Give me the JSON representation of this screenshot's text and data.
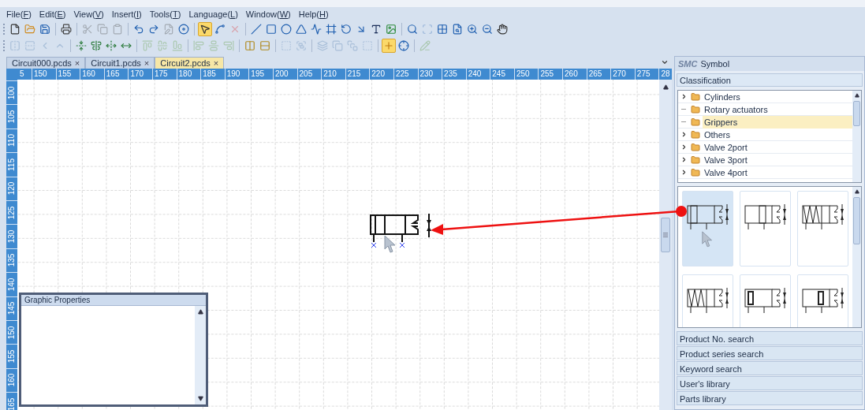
{
  "menu": [
    {
      "label": "File(F)"
    },
    {
      "label": "Edit(E)"
    },
    {
      "label": "View(V)"
    },
    {
      "label": "Insert(I)"
    },
    {
      "label": "Tools(T)"
    },
    {
      "label": "Language(L)"
    },
    {
      "label": "Window(W)"
    },
    {
      "label": "Help(H)"
    }
  ],
  "toolbars": [
    [
      {
        "disabled": false,
        "selected": false
      },
      {
        "disabled": false,
        "selected": false
      },
      {
        "disabled": false,
        "selected": false
      },
      {
        "disabled": false,
        "selected": false
      },
      {
        "disabled": true,
        "selected": false
      },
      {
        "disabled": true,
        "selected": false
      },
      {
        "disabled": true,
        "selected": false
      },
      {
        "disabled": false,
        "selected": false
      },
      {
        "disabled": false,
        "selected": false
      },
      {
        "disabled": true,
        "selected": false
      },
      {
        "disabled": false,
        "selected": false
      },
      {
        "disabled": false,
        "selected": true
      },
      {
        "disabled": false,
        "selected": false
      },
      {
        "disabled": true,
        "selected": false
      },
      {
        "disabled": false,
        "selected": false
      },
      {
        "disabled": false,
        "selected": false
      },
      {
        "disabled": false,
        "selected": false
      },
      {
        "disabled": false,
        "selected": false
      },
      {
        "disabled": false,
        "selected": false
      },
      {
        "disabled": false,
        "selected": false
      },
      {
        "disabled": false,
        "selected": false
      },
      {
        "disabled": false,
        "selected": false
      },
      {
        "disabled": false,
        "selected": false
      },
      {
        "disabled": false,
        "selected": false
      },
      {
        "disabled": false,
        "selected": false
      },
      {
        "disabled": true,
        "selected": false
      },
      {
        "disabled": false,
        "selected": false
      },
      {
        "disabled": false,
        "selected": false
      },
      {
        "disabled": false,
        "selected": false
      },
      {
        "disabled": false,
        "selected": false
      },
      {
        "disabled": false,
        "selected": false
      }
    ],
    [
      {
        "disabled": true,
        "selected": false
      },
      {
        "disabled": true,
        "selected": false
      },
      {
        "disabled": true,
        "selected": false
      },
      {
        "disabled": true,
        "selected": false
      },
      {
        "disabled": false,
        "selected": false
      },
      {
        "disabled": false,
        "selected": false
      },
      {
        "disabled": false,
        "selected": false
      },
      {
        "disabled": false,
        "selected": false
      },
      {
        "disabled": true,
        "selected": false
      },
      {
        "disabled": true,
        "selected": false
      },
      {
        "disabled": true,
        "selected": false
      },
      {
        "disabled": true,
        "selected": false
      },
      {
        "disabled": true,
        "selected": false
      },
      {
        "disabled": true,
        "selected": false
      },
      {
        "disabled": false,
        "selected": false
      },
      {
        "disabled": false,
        "selected": false
      },
      {
        "disabled": true,
        "selected": false
      },
      {
        "disabled": true,
        "selected": false
      },
      {
        "disabled": true,
        "selected": false
      },
      {
        "disabled": true,
        "selected": false
      },
      {
        "disabled": true,
        "selected": false
      },
      {
        "disabled": true,
        "selected": false
      },
      {
        "disabled": false,
        "selected": true
      },
      {
        "disabled": false,
        "selected": false
      },
      {
        "disabled": true,
        "selected": false
      }
    ]
  ],
  "tabs": [
    {
      "label": "Circuit000.pcds",
      "close": "×",
      "selected": false
    },
    {
      "label": "Circuit1.pcds",
      "close": "×",
      "selected": false
    },
    {
      "label": "Circuit2.pcds",
      "close": "×",
      "selected": true
    }
  ],
  "ruler": {
    "horizontal": [
      "5",
      "150",
      "155",
      "160",
      "165",
      "170",
      "175",
      "180",
      "185",
      "190",
      "195",
      "200",
      "205",
      "210",
      "215",
      "220",
      "225",
      "230",
      "235",
      "240",
      "245",
      "250",
      "255",
      "260",
      "265",
      "270",
      "275",
      "28"
    ],
    "vertical": [
      "100",
      "105",
      "110",
      "115",
      "120",
      "125",
      "130",
      "135",
      "140",
      "145",
      "150",
      "155",
      "160",
      "165"
    ]
  },
  "graphic_properties": {
    "title": "Graphic Properties"
  },
  "symbol_panel": {
    "logo": "SMC",
    "title": "Symbol",
    "classification": "Classification",
    "tree": [
      {
        "label": "Cylinders",
        "expandable": true,
        "selected": false
      },
      {
        "label": "Rotary actuators",
        "expandable": false,
        "selected": false
      },
      {
        "label": "Grippers",
        "expandable": false,
        "selected": true
      },
      {
        "label": "Others",
        "expandable": true,
        "selected": false
      },
      {
        "label": "Valve 2port",
        "expandable": true,
        "selected": false
      },
      {
        "label": "Valve 3port",
        "expandable": true,
        "selected": false
      },
      {
        "label": "Valve 4port",
        "expandable": true,
        "selected": false
      }
    ],
    "symbols": [
      {
        "selected": true
      },
      {
        "selected": false
      },
      {
        "selected": false
      },
      {
        "selected": false
      },
      {
        "selected": false
      },
      {
        "selected": false
      }
    ]
  },
  "sections": [
    "Product No. search",
    "Product series search",
    "Keyword search",
    "User's library",
    "Parts library"
  ]
}
